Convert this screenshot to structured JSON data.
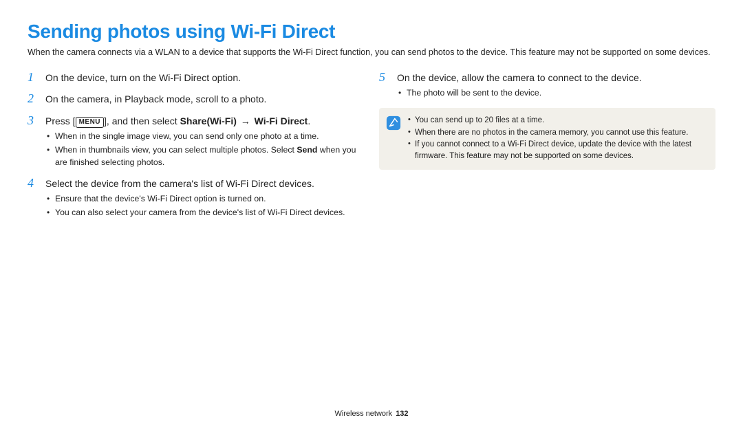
{
  "title": "Sending photos using Wi-Fi Direct",
  "intro": "When the camera connects via a WLAN to a device that supports the Wi-Fi Direct function, you can send photos to the device. This feature may not be supported on some devices.",
  "left": {
    "step1": {
      "num": "1",
      "text": "On the device, turn on the Wi-Fi Direct option."
    },
    "step2": {
      "num": "2",
      "text": "On the camera, in Playback mode, scroll to a photo."
    },
    "step3": {
      "num": "3",
      "pre": "Press [",
      "menu": "MENU",
      "mid": "], and then select ",
      "bold1": "Share(Wi-Fi)",
      "arrow": "→",
      "bold2": "Wi-Fi Direct",
      "post": ".",
      "subs": [
        "When in the single image view, you can send only one photo at a time.",
        "When in thumbnails view, you can select multiple photos. Select Send when you are finished selecting photos."
      ],
      "sub1": "When in the single image view, you can send only one photo at a time.",
      "sub2_pre": "When in thumbnails view, you can select multiple photos. Select ",
      "sub2_bold": "Send",
      "sub2_post": " when you are finished selecting photos."
    },
    "step4": {
      "num": "4",
      "text": "Select the device from the camera's list of Wi-Fi Direct devices.",
      "sub1": "Ensure that the device's Wi-Fi Direct option is turned on.",
      "sub2": "You can also select your camera from the device's list of Wi-Fi Direct devices."
    }
  },
  "right": {
    "step5": {
      "num": "5",
      "text": "On the device, allow the camera to connect to the device.",
      "sub1": "The photo will be sent to the device."
    },
    "note": {
      "n1": "You can send up to 20 files at a time.",
      "n2": "When there are no photos in the camera memory, you cannot use this feature.",
      "n3": "If you cannot connect to a Wi-Fi Direct device, update the device with the latest firmware. This feature may not be supported on some devices."
    }
  },
  "footer": {
    "section": "Wireless network",
    "page": "132"
  }
}
